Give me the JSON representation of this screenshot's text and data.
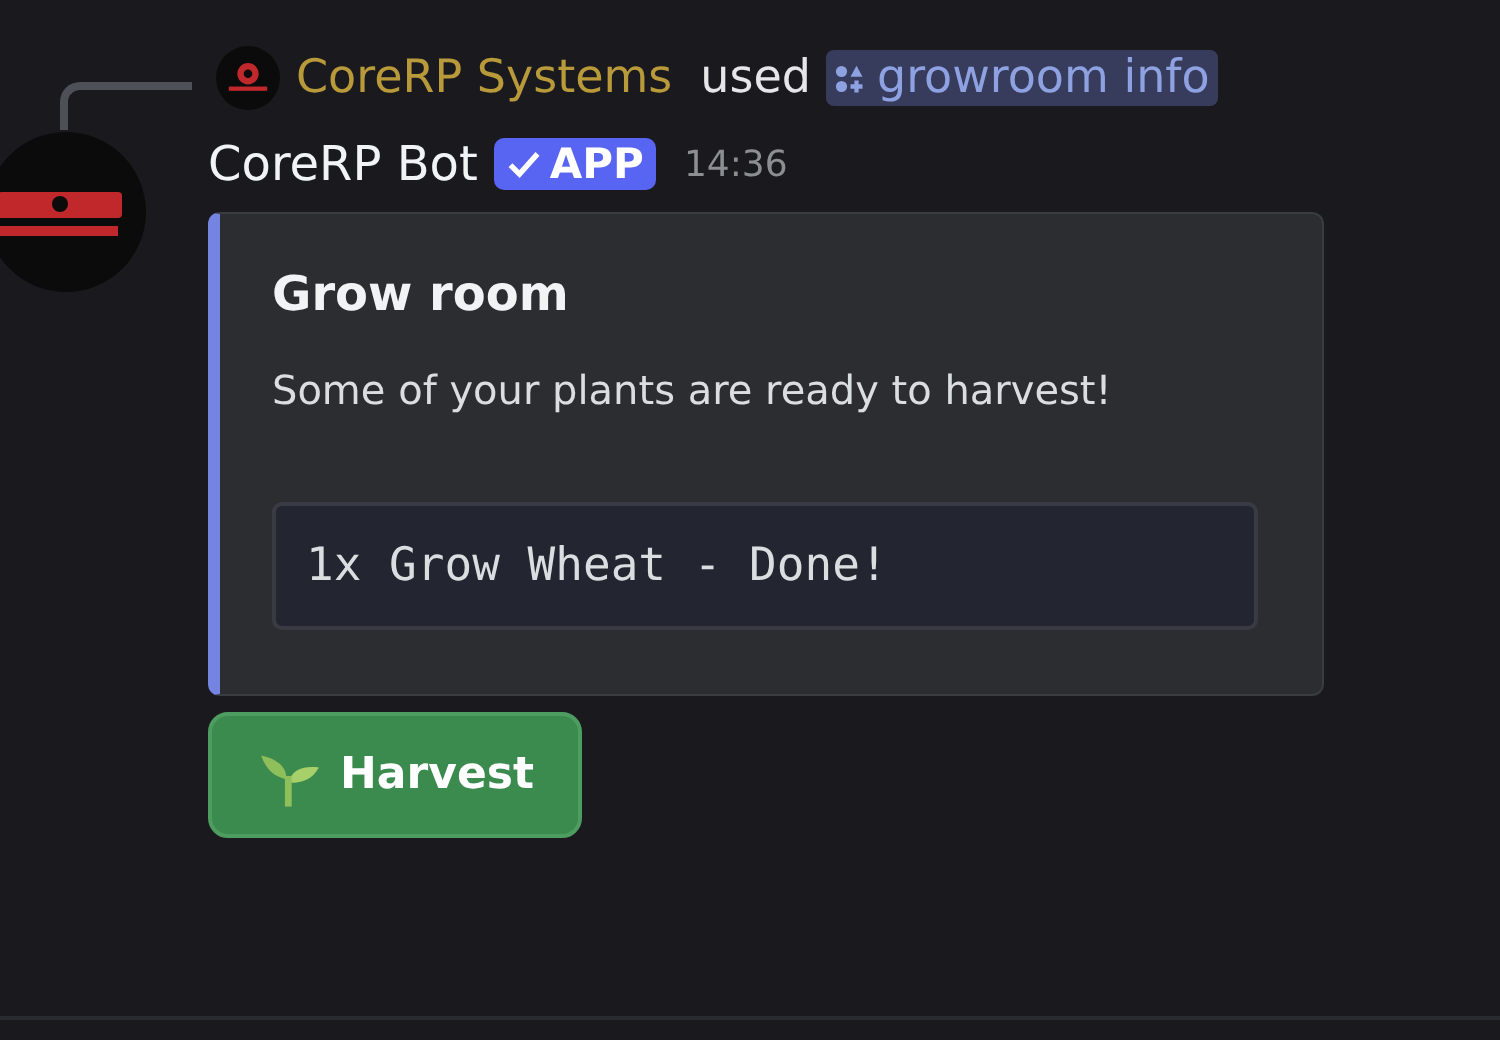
{
  "reply": {
    "user": "CoreRP Systems",
    "action": "used",
    "command": "growroom info"
  },
  "message": {
    "author": "CoreRP Bot",
    "badge": "APP",
    "time": "14:36"
  },
  "embed": {
    "title": "Grow room",
    "description": "Some of your plants are ready to harvest!",
    "code": "1x Grow Wheat - Done!"
  },
  "buttons": [
    {
      "label": "Harvest",
      "kind": "success"
    }
  ]
}
